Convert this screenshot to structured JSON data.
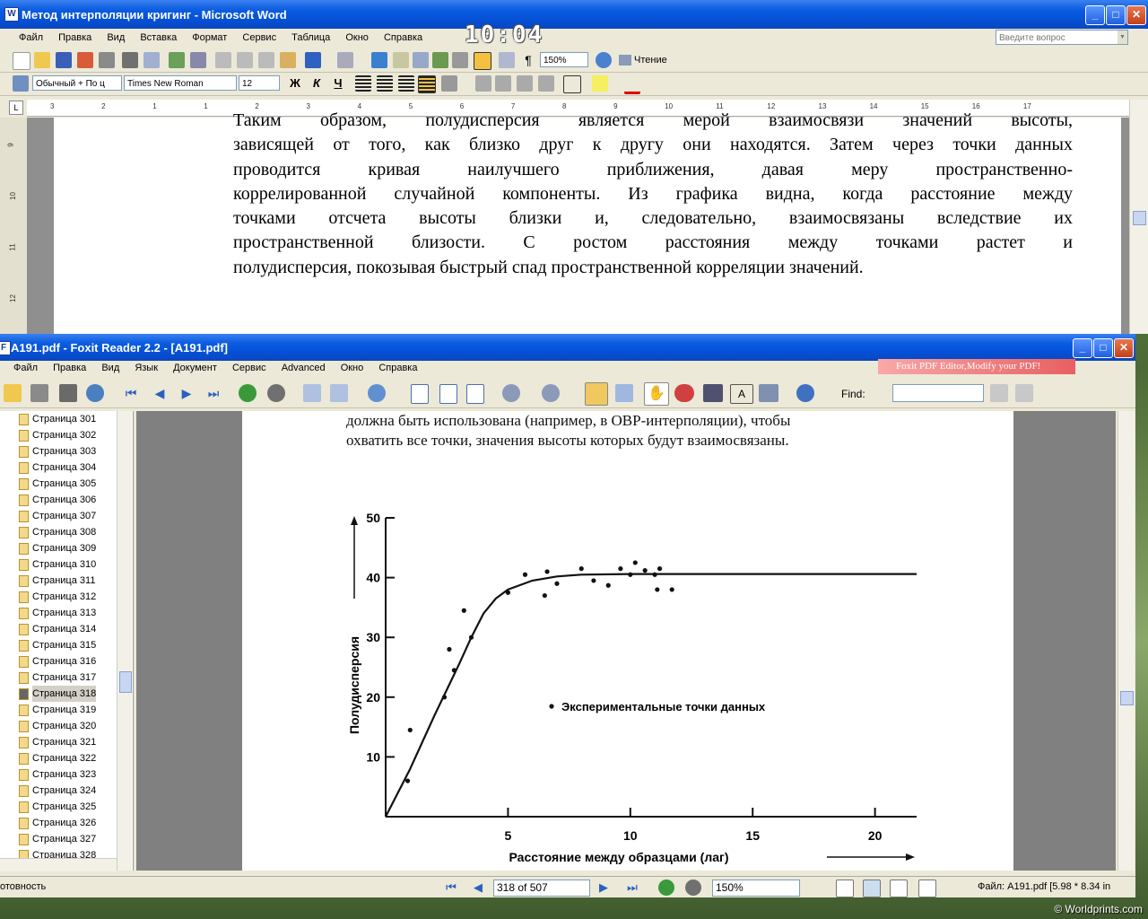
{
  "word": {
    "title": "Метод интерполяции кригинг - Microsoft Word",
    "menu": [
      "Файл",
      "Правка",
      "Вид",
      "Вставка",
      "Формат",
      "Сервис",
      "Таблица",
      "Окно",
      "Справка"
    ],
    "clock": "10:04",
    "help_placeholder": "Введите вопрос",
    "zoom": "150%",
    "reading_label": "Чтение",
    "style": "Обычный + По ц",
    "font": "Times New Roman",
    "size": "12",
    "bold": "Ж",
    "italic": "К",
    "underline": "Ч",
    "ruler_numbers": [
      "3",
      "2",
      "1",
      "1",
      "2",
      "3",
      "4",
      "5",
      "6",
      "7",
      "8",
      "9",
      "10",
      "11",
      "12",
      "13",
      "14",
      "15",
      "16",
      "17"
    ],
    "vruler_numbers": [
      "9",
      "10",
      "11",
      "12"
    ],
    "lines": [
      "Таким образом, полудисперсия является мерой взаимосвязи значений высоты,",
      "зависящей от того, как близко друг к другу они находятся. Затем через точки данных",
      "проводится кривая наилучшего приближения, давая меру пространственно-",
      "коррелированной случайной компоненты. Из графика видна, когда расстояние между",
      "точками отсчета высоты близки и, следовательно, взаимосвязаны вследствие их",
      "пространственной близости. С ростом расстояния между точками растет и",
      "полудисперсия, покозывая быстрый спад пространственной корреляции значений."
    ]
  },
  "foxit": {
    "title": "A191.pdf - Foxit Reader 2.2 - [A191.pdf]",
    "menu": [
      "Файл",
      "Правка",
      "Вид",
      "Язык",
      "Документ",
      "Сервис",
      "Advanced",
      "Окно",
      "Справка"
    ],
    "ad": "Foxit PDF Editor,Modify your PDF!",
    "find_label": "Find:",
    "nav_items": [
      "Страница 301",
      "Страница 302",
      "Страница 303",
      "Страница 304",
      "Страница 305",
      "Страница 306",
      "Страница 307",
      "Страница 308",
      "Страница 309",
      "Страница 310",
      "Страница 311",
      "Страница 312",
      "Страница 313",
      "Страница 314",
      "Страница 315",
      "Страница 316",
      "Страница 317",
      "Страница 318",
      "Страница 319",
      "Страница 320",
      "Страница 321",
      "Страница 322",
      "Страница 323",
      "Страница 324",
      "Страница 325",
      "Страница 326",
      "Страница 327",
      "Страница 328"
    ],
    "selected_nav": 17,
    "pdf_lines": [
      "должна быть использована (например, в ОВР-интерполяции), чтобы",
      "охватить все точки, значения высоты которых будут взаимосвязаны."
    ],
    "status_left": "отовность",
    "page_indicator": "318 of 507",
    "zoom": "150%",
    "file_info": "Файл: A191.pdf [5.98 * 8.34 in"
  },
  "chart_data": {
    "type": "scatter",
    "ylabel": "Полудисперсия",
    "xlabel": "Расстояние между образцами (лаг)",
    "legend": "Экспериментальные точки данных",
    "x_ticks": [
      5,
      10,
      15,
      20
    ],
    "y_ticks": [
      10,
      20,
      30,
      40,
      50
    ],
    "xlim": [
      0,
      21.7
    ],
    "ylim": [
      0,
      50
    ],
    "points": [
      [
        0.9,
        6
      ],
      [
        1.0,
        14.5
      ],
      [
        2.4,
        20
      ],
      [
        2.6,
        28
      ],
      [
        2.8,
        24.5
      ],
      [
        3.2,
        34.5
      ],
      [
        3.5,
        30
      ],
      [
        5.0,
        37.5
      ],
      [
        5.7,
        40.5
      ],
      [
        6.5,
        37
      ],
      [
        6.6,
        41
      ],
      [
        7.0,
        39
      ],
      [
        8.0,
        41.5
      ],
      [
        8.5,
        39.5
      ],
      [
        9.1,
        38.7
      ],
      [
        9.6,
        41.5
      ],
      [
        10.0,
        40.5
      ],
      [
        10.2,
        42.5
      ],
      [
        10.6,
        41.2
      ],
      [
        11.0,
        40.5
      ],
      [
        11.1,
        38
      ],
      [
        11.2,
        41.5
      ],
      [
        11.7,
        38
      ]
    ],
    "curve": [
      [
        0,
        0
      ],
      [
        1,
        8
      ],
      [
        2,
        17
      ],
      [
        3,
        25.5
      ],
      [
        3.5,
        30
      ],
      [
        4,
        34
      ],
      [
        4.5,
        36.5
      ],
      [
        5,
        38
      ],
      [
        6,
        39.5
      ],
      [
        7,
        40.2
      ],
      [
        8,
        40.5
      ],
      [
        10,
        40.6
      ],
      [
        15,
        40.6
      ],
      [
        21.7,
        40.6
      ]
    ]
  }
}
